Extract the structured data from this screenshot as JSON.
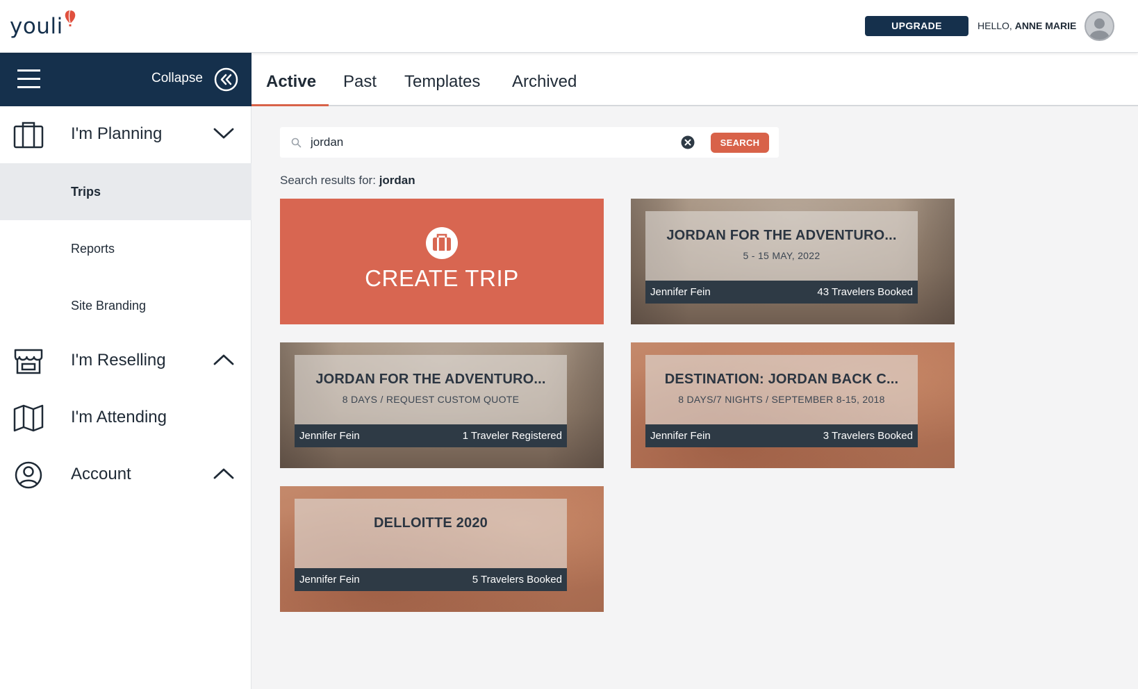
{
  "header": {
    "logo_text": "youli",
    "upgrade_label": "UPGRADE",
    "greeting_prefix": "HELLO,",
    "user_name": "ANNE MARIE"
  },
  "sidebar": {
    "collapse_label": "Collapse",
    "sections": [
      {
        "label": "I'm Planning",
        "icon": "suitcase-icon",
        "chevron": "chevron-down-icon"
      },
      {
        "label": "I'm Reselling",
        "icon": "storefront-icon",
        "chevron": "chevron-up-icon"
      },
      {
        "label": "I'm Attending",
        "icon": "map-icon"
      },
      {
        "label": "Account",
        "icon": "user-circle-icon",
        "chevron": "chevron-up-icon"
      }
    ],
    "sub_items": [
      "Trips",
      "Reports",
      "Site Branding"
    ],
    "active_sub_item": "Trips"
  },
  "tabs": {
    "items": [
      "Active",
      "Past",
      "Templates",
      "Archived"
    ],
    "active": "Active"
  },
  "search": {
    "value": "jordan",
    "button_label": "SEARCH",
    "results_prefix": "Search results for:",
    "results_query": "jordan"
  },
  "create_trip": {
    "label": "CREATE TRIP"
  },
  "trips": [
    {
      "title": "JORDAN FOR THE ADVENTURO...",
      "subtitle": "5 - 15 MAY, 2022",
      "owner": "Jennifer Fein",
      "count": "43 Travelers Booked"
    },
    {
      "title": "JORDAN FOR THE ADVENTURO...",
      "subtitle": "8 DAYS / REQUEST CUSTOM QUOTE",
      "owner": "Jennifer Fein",
      "count": "1 Traveler Registered"
    },
    {
      "title": "DESTINATION: JORDAN BACK C...",
      "subtitle": "8 DAYS/7 NIGHTS / SEPTEMBER 8-15, 2018",
      "owner": "Jennifer Fein",
      "count": "3 Travelers Booked"
    },
    {
      "title": "DELLOITTE 2020",
      "subtitle": "",
      "owner": "Jennifer Fein",
      "count": "5 Travelers Booked"
    }
  ],
  "colors": {
    "navy": "#15304c",
    "accent": "#d86249",
    "create_card": "#d86651"
  }
}
